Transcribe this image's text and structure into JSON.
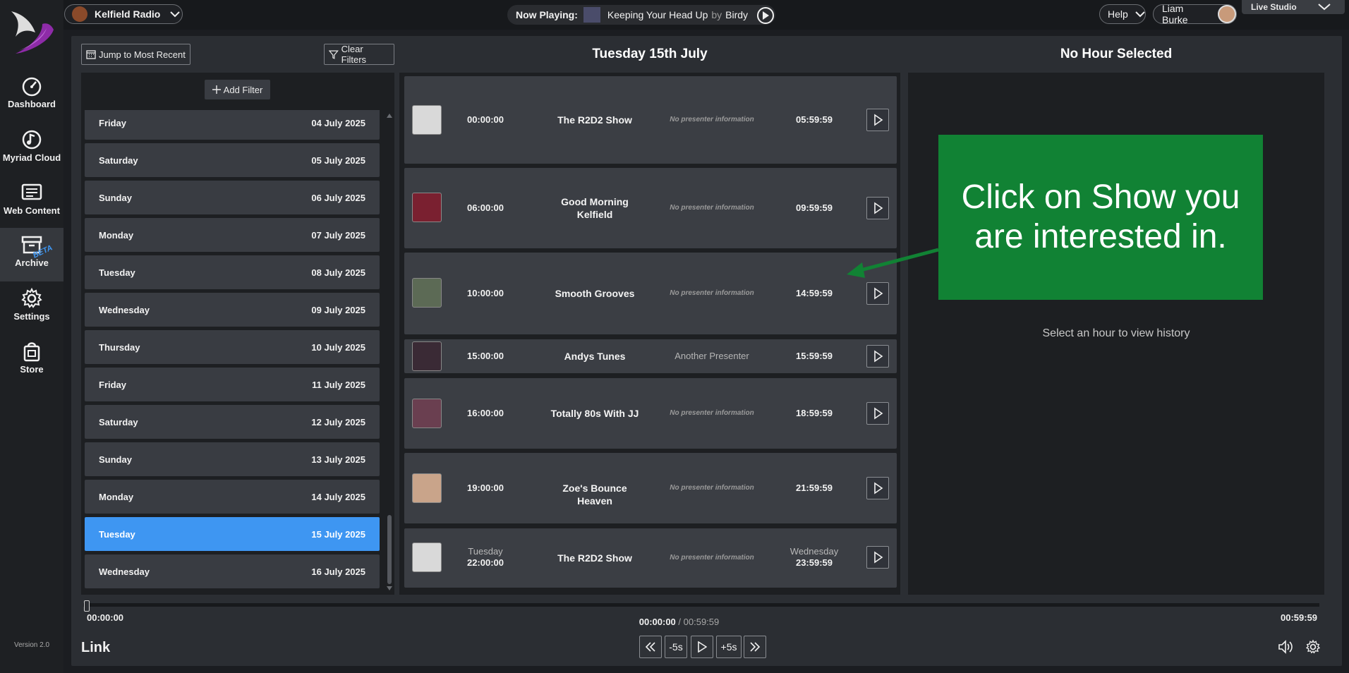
{
  "topbar": {
    "station": "Kelfield Radio",
    "now_playing_label": "Now Playing:",
    "track": "Keeping Your Head Up",
    "by_word": "by",
    "artist": "Birdy",
    "help_label": "Help",
    "user_name": "Liam Burke",
    "studio_label": "Live Studio"
  },
  "sidebar": {
    "items": [
      {
        "label": "Dashboard",
        "icon": "gauge-icon"
      },
      {
        "label": "Myriad Cloud",
        "icon": "cloud-music-icon"
      },
      {
        "label": "Web Content",
        "icon": "web-content-icon"
      },
      {
        "label": "Archive",
        "icon": "archive-icon",
        "badge": "BETA"
      },
      {
        "label": "Settings",
        "icon": "gear-icon"
      },
      {
        "label": "Store",
        "icon": "store-icon"
      }
    ],
    "version": "Version 2.0"
  },
  "toolbar": {
    "jump_label": "Jump to Most Recent",
    "clear_filters_label": "Clear Filters",
    "add_filter_label": "Add Filter",
    "selected_day_heading": "Tuesday 15th July",
    "hour_heading": "No Hour Selected"
  },
  "dates": [
    {
      "day": "Friday",
      "date": "04 July 2025",
      "selected": false
    },
    {
      "day": "Saturday",
      "date": "05 July 2025",
      "selected": false
    },
    {
      "day": "Sunday",
      "date": "06 July 2025",
      "selected": false
    },
    {
      "day": "Monday",
      "date": "07 July 2025",
      "selected": false
    },
    {
      "day": "Tuesday",
      "date": "08 July 2025",
      "selected": false
    },
    {
      "day": "Wednesday",
      "date": "09 July 2025",
      "selected": false
    },
    {
      "day": "Thursday",
      "date": "10 July 2025",
      "selected": false
    },
    {
      "day": "Friday",
      "date": "11 July 2025",
      "selected": false
    },
    {
      "day": "Saturday",
      "date": "12 July 2025",
      "selected": false
    },
    {
      "day": "Sunday",
      "date": "13 July 2025",
      "selected": false
    },
    {
      "day": "Monday",
      "date": "14 July 2025",
      "selected": false
    },
    {
      "day": "Tuesday",
      "date": "15 July 2025",
      "selected": true
    },
    {
      "day": "Wednesday",
      "date": "16 July 2025",
      "selected": false
    }
  ],
  "shows": [
    {
      "start_day": "",
      "start": "00:00:00",
      "title": "The R2D2 Show",
      "presenter": "No presenter information",
      "end_day": "",
      "end": "05:59:59",
      "thumb_color": "#d9d9d9"
    },
    {
      "start_day": "",
      "start": "06:00:00",
      "title": "Good Morning Kelfield",
      "presenter": "No presenter information",
      "end_day": "",
      "end": "09:59:59",
      "thumb_color": "#7a2030"
    },
    {
      "start_day": "",
      "start": "10:00:00",
      "title": "Smooth Grooves",
      "presenter": "No presenter information",
      "end_day": "",
      "end": "14:59:59",
      "thumb_color": "#5c6a55"
    },
    {
      "start_day": "",
      "start": "15:00:00",
      "title": "Andys Tunes",
      "presenter": "Another Presenter",
      "end_day": "",
      "end": "15:59:59",
      "thumb_color": "#3a2a35"
    },
    {
      "start_day": "",
      "start": "16:00:00",
      "title": "Totally 80s With JJ",
      "presenter": "No presenter information",
      "end_day": "",
      "end": "18:59:59",
      "thumb_color": "#6a3f50"
    },
    {
      "start_day": "",
      "start": "19:00:00",
      "title": "Zoe's Bounce Heaven",
      "presenter": "No presenter information",
      "end_day": "",
      "end": "21:59:59",
      "thumb_color": "#c9a48a"
    },
    {
      "start_day": "Tuesday",
      "start": "22:00:00",
      "title": "The R2D2 Show",
      "presenter": "No presenter information",
      "end_day": "Wednesday",
      "end": "23:59:59",
      "thumb_color": "#d9d9d9"
    }
  ],
  "history": {
    "empty_text": "Select an hour to view history"
  },
  "callout": {
    "text": "Click on Show you are interested in."
  },
  "player": {
    "start_time": "00:00:00",
    "current": "00:00:00",
    "separator": " / ",
    "duration": "00:59:59",
    "end_time": "00:59:59",
    "link_label": "Link",
    "back5_label": "-5s",
    "fwd5_label": "+5s",
    "progress": 0
  },
  "colors": {
    "accent": "#3e96f2",
    "callout_green": "#118234",
    "logo_purple": "#8e2ba8"
  }
}
